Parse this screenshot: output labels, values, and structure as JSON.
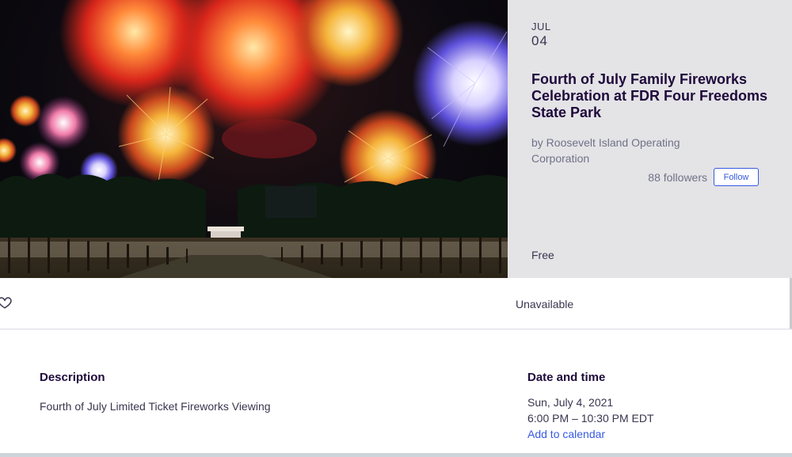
{
  "event": {
    "month": "JUL",
    "day": "04",
    "title": "Fourth of July Family Fireworks Celebration at FDR Four Freedoms State Park",
    "organizer": "by Roosevelt Island Operating Corporation",
    "followers": "88 followers",
    "follow_label": "Follow",
    "price": "Free"
  },
  "actions": {
    "heart_icon": "heart-outline-icon",
    "status": "Unavailable"
  },
  "description": {
    "heading": "Description",
    "text": "Fourth of July Limited Ticket Fireworks Viewing"
  },
  "datetime": {
    "heading": "Date and time",
    "date": "Sun, July 4, 2021",
    "time": "6:00 PM – 10:30 PM EDT",
    "add_to_calendar": "Add to calendar"
  },
  "colors": {
    "link": "#3659e3",
    "title": "#1e0a3c",
    "muted": "#6f7287",
    "info_panel": "#e4e3e6"
  }
}
